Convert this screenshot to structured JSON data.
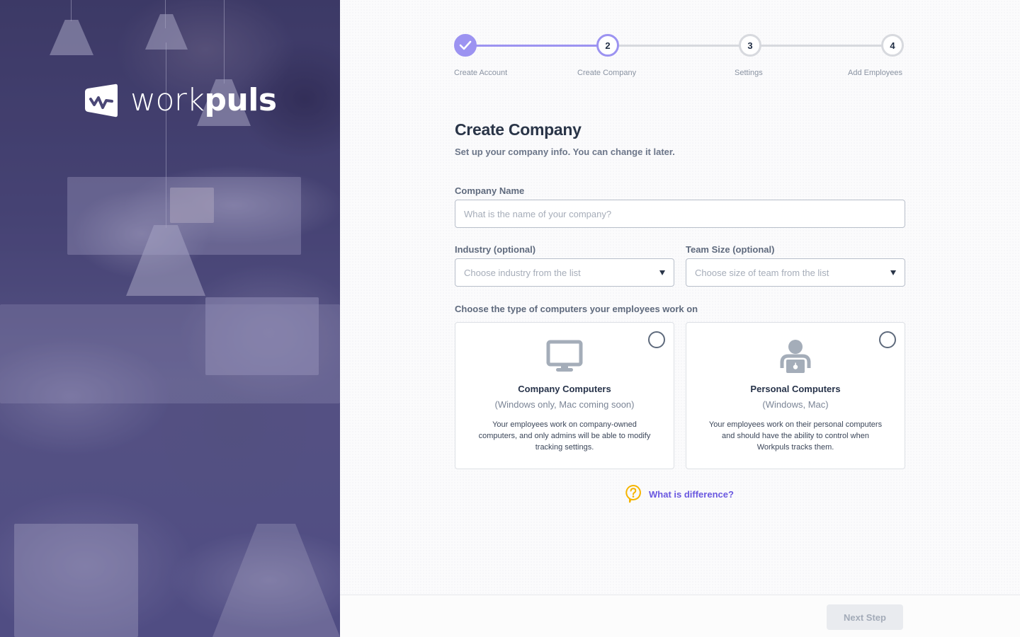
{
  "brand": {
    "name_light": "work",
    "name_bold": "puls",
    "logo_icon": "pulse-flag-icon"
  },
  "colors": {
    "accent": "#9c93f1",
    "link": "#6a58e0",
    "help_icon": "#f5b400",
    "hero_overlay": "#4a4776"
  },
  "stepper": {
    "current_step": 2,
    "steps": [
      {
        "number": "1",
        "label": "Create Account",
        "state": "done",
        "icon": "check-icon"
      },
      {
        "number": "2",
        "label": "Create Company",
        "state": "active"
      },
      {
        "number": "3",
        "label": "Settings",
        "state": "pending"
      },
      {
        "number": "4",
        "label": "Add Employees",
        "state": "pending"
      }
    ]
  },
  "form": {
    "title": "Create Company",
    "subtitle": "Set up your company info. You can change it later.",
    "company_name": {
      "label": "Company Name",
      "value": "",
      "placeholder": "What is the name of your company?"
    },
    "industry": {
      "label": "Industry (optional)",
      "placeholder": "Choose industry from the list"
    },
    "team_size": {
      "label": "Team Size (optional)",
      "placeholder": "Choose size of team from the list"
    },
    "computers_label": "Choose the type of computers your employees work on",
    "computer_types": [
      {
        "icon": "desktop-monitor-icon",
        "title": "Company Computers",
        "sub": "(Windows only, Mac coming soon)",
        "desc": "Your employees work on company-owned computers, and only admins will be able to modify tracking settings.",
        "selected": false
      },
      {
        "icon": "person-laptop-icon",
        "title": "Personal Computers",
        "sub": "(Windows, Mac)",
        "desc": "Your employees work on their personal computers and should have the ability to control when Workpuls tracks them.",
        "selected": false
      }
    ],
    "help_link": "What is difference?"
  },
  "footer": {
    "next_label": "Next Step",
    "next_enabled": false
  }
}
